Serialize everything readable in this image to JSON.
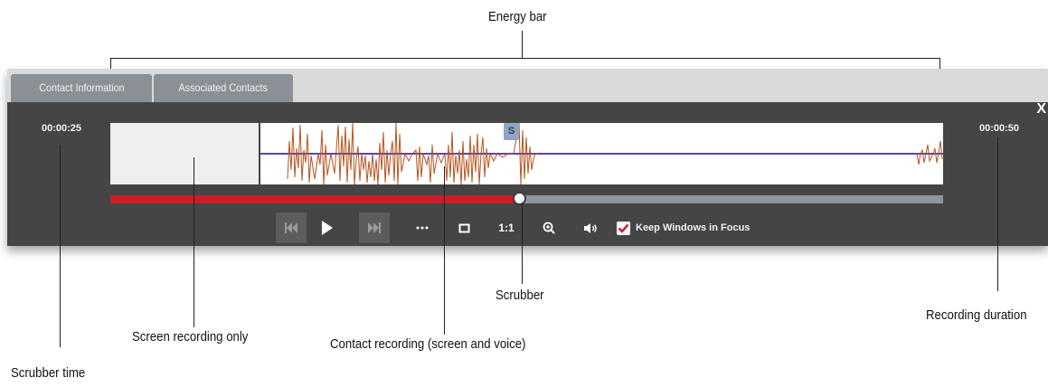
{
  "annotations": {
    "energy_bar": "Energy bar",
    "scrubber": "Scrubber",
    "recording_duration": "Recording duration",
    "screen_recording_only": "Screen recording only",
    "contact_recording": "Contact recording (screen and voice)",
    "scrubber_time": "Scrubber time"
  },
  "tabs": [
    {
      "label": "Contact Information"
    },
    {
      "label": "Associated Contacts"
    }
  ],
  "player": {
    "close_label": "X",
    "scrubber_time": "00:00:25",
    "duration": "00:00:50",
    "progress_fraction": 0.49,
    "screen_marker_label": "S",
    "keep_windows_label": "Keep Windows in Focus",
    "keep_windows_checked": true,
    "ratio_label": "1:1"
  },
  "colors": {
    "panel": "#454545",
    "progress_played": "#c91f2a",
    "progress_remaining": "#8f979e",
    "energy_wave": "#b5541e",
    "energy_baseline": "#5a3fc4",
    "checkbox_tick": "#d0212f"
  },
  "icons": {
    "skip_back": "skip-back-icon",
    "play": "play-icon",
    "skip_forward": "skip-forward-icon",
    "more": "more-dots-icon",
    "fullscreen": "fullscreen-icon",
    "zoom": "zoom-in-icon",
    "volume": "volume-icon"
  }
}
